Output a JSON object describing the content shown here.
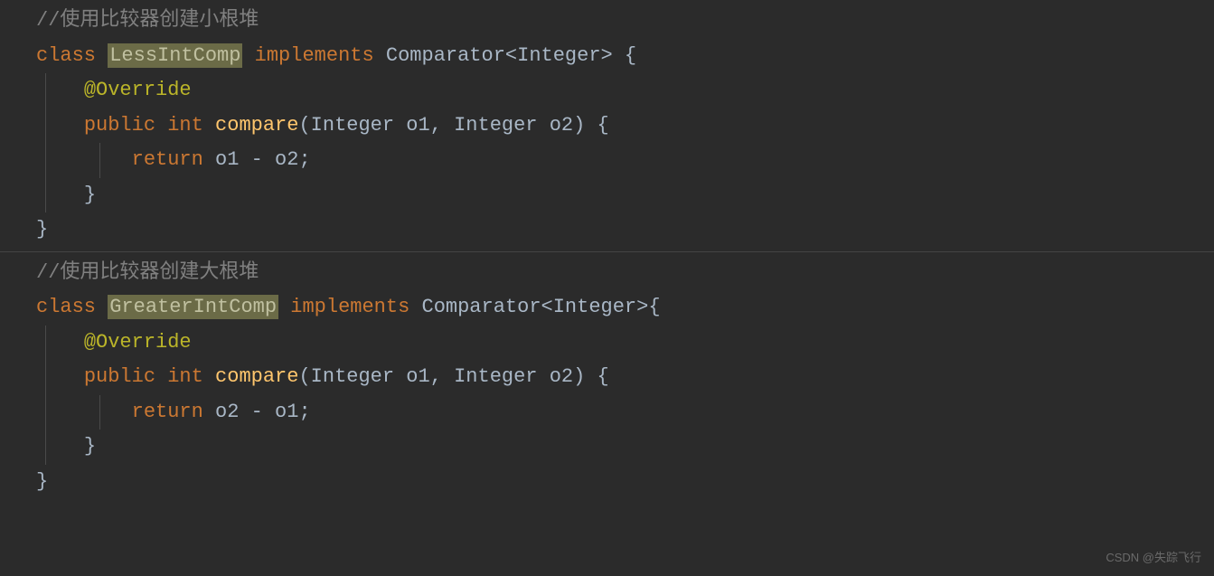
{
  "block1": {
    "comment": "//使用比较器创建小根堆",
    "kw_class": "class ",
    "class_name": "LessIntComp",
    "kw_implements": " implements ",
    "interface": "Comparator<Integer> {",
    "annotation": "@Override",
    "kw_public": "public ",
    "kw_int": "int ",
    "method_name": "compare",
    "params": "(Integer o1, Integer o2) {",
    "kw_return": "return ",
    "expr": "o1 - o2;",
    "close_brace_inner": "}",
    "close_brace_outer": "}"
  },
  "block2": {
    "comment": "//使用比较器创建大根堆",
    "kw_class": "class ",
    "class_name": "GreaterIntComp",
    "kw_implements": " implements ",
    "interface": "Comparator<Integer>{",
    "annotation": "@Override",
    "kw_public": "public ",
    "kw_int": "int ",
    "method_name": "compare",
    "params": "(Integer o1, Integer o2) {",
    "kw_return": "return ",
    "expr": "o2 - o1;",
    "close_brace_inner": "}",
    "close_brace_outer": "}"
  },
  "watermark": "CSDN @失踪飞行"
}
